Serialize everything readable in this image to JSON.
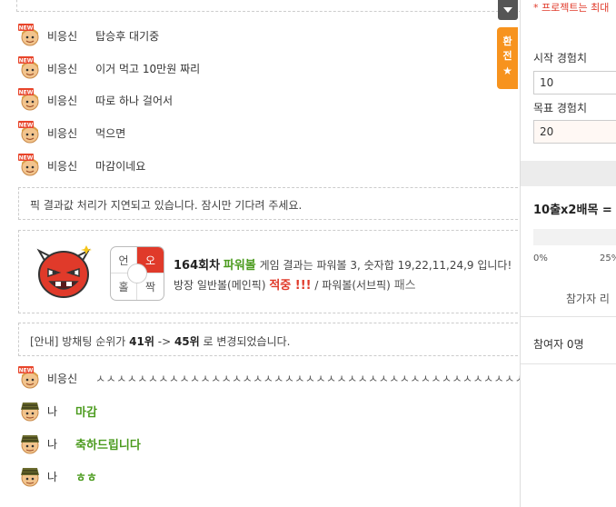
{
  "chat": {
    "new_badge": "NEW",
    "messages": [
      {
        "nick": "비응신",
        "text": "탑승후 대기중"
      },
      {
        "nick": "비응신",
        "text": "이거 먹고 10만원 짜리"
      },
      {
        "nick": "비응신",
        "text": "따로 하나 걸어서"
      },
      {
        "nick": "비응신",
        "text": "먹으면"
      },
      {
        "nick": "비응신",
        "text": "마감이네요"
      }
    ],
    "notice": "픽 결과값 처리가 지연되고 있습니다. 잠시만 기다려 주세요.",
    "result": {
      "cells": {
        "tl": "언",
        "tr": "오",
        "bl": "홀",
        "br": "짝"
      },
      "round": "164회차",
      "game": "파워볼",
      "line1_rest": "게임 결과는 파워볼 3, 숫자합 19,22,11,24,9 입니다!",
      "line2_a": "방장 일반볼(메인픽)",
      "hit": "적중 !!!",
      "line2_b": "/ 파워볼(서브픽)",
      "pass": "패스"
    },
    "rank": {
      "prefix": "[안내] 방채팅 순위가",
      "from": "41위",
      "arrow": "->",
      "to": "45위",
      "suffix": "로 변경되었습니다."
    },
    "messages2": [
      {
        "nick": "비응신",
        "text": "ㅅㅅㅅㅅㅅㅅㅅㅅㅅㅅㅅㅅㅅㅅㅅㅅㅅㅅㅅㅅㅅㅅㅅㅅㅅㅅㅅㅅㅅㅅㅅㅅㅅㅅㅅㅅㅅㅅㅅㅅㅅㅅㅅㅅ"
      },
      {
        "nick": "나",
        "text": "마감"
      },
      {
        "nick": "나",
        "text": "축하드립니다"
      },
      {
        "nick": "나",
        "text": "ㅎㅎ"
      }
    ]
  },
  "side_tab": {
    "label": "환전",
    "star": "★"
  },
  "panel": {
    "note": "* 프로젝트는 최대",
    "start_label": "시작 경험치",
    "start_value": "10",
    "target_label": "목표 경험치",
    "target_value": "20",
    "bet_text": "10출x2배목 =",
    "tick_0": "0%",
    "tick_25": "25%",
    "participants_header": "참가자 리",
    "participants_count": "참여자 0명"
  },
  "colors": {
    "accent_orange": "#f7931e",
    "green": "#4b9b1e",
    "red": "#e03a2a"
  },
  "icons": [
    "new-badge-avatar-icon",
    "my-avatar-icon",
    "devil-mascot-icon",
    "scroll-down-icon",
    "star-icon"
  ]
}
